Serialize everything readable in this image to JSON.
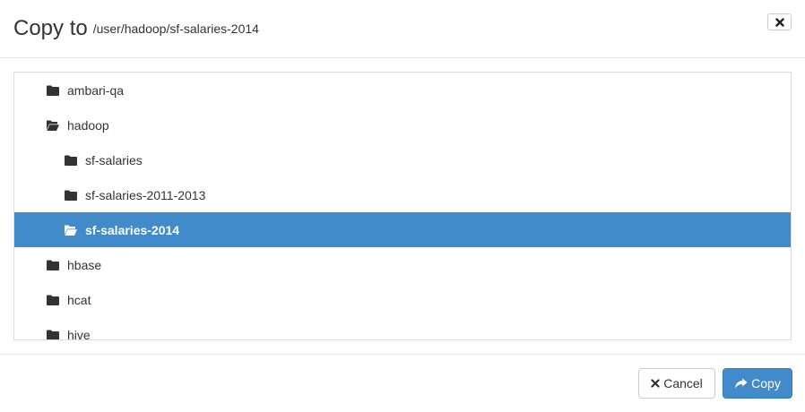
{
  "header": {
    "title": "Copy to",
    "path": "/user/hadoop/sf-salaries-2014",
    "close_icon": "close-icon"
  },
  "tree": {
    "items": [
      {
        "label": "ambari-qa",
        "icon": "folder-closed-icon",
        "level": 0,
        "open": false,
        "selected": false
      },
      {
        "label": "hadoop",
        "icon": "folder-open-icon",
        "level": 0,
        "open": true,
        "selected": false
      },
      {
        "label": "sf-salaries",
        "icon": "folder-closed-icon",
        "level": 1,
        "open": false,
        "selected": false
      },
      {
        "label": "sf-salaries-2011-2013",
        "icon": "folder-closed-icon",
        "level": 1,
        "open": false,
        "selected": false
      },
      {
        "label": "sf-salaries-2014",
        "icon": "folder-open-icon",
        "level": 1,
        "open": true,
        "selected": true
      },
      {
        "label": "hbase",
        "icon": "folder-closed-icon",
        "level": 0,
        "open": false,
        "selected": false
      },
      {
        "label": "hcat",
        "icon": "folder-closed-icon",
        "level": 0,
        "open": false,
        "selected": false
      },
      {
        "label": "hive",
        "icon": "folder-closed-icon",
        "level": 0,
        "open": false,
        "selected": false
      }
    ],
    "selected_color": "#428bca"
  },
  "footer": {
    "cancel_label": "Cancel",
    "copy_label": "Copy",
    "cancel_icon": "times-icon",
    "copy_icon": "share-arrow-icon",
    "primary_color": "#428bca"
  }
}
